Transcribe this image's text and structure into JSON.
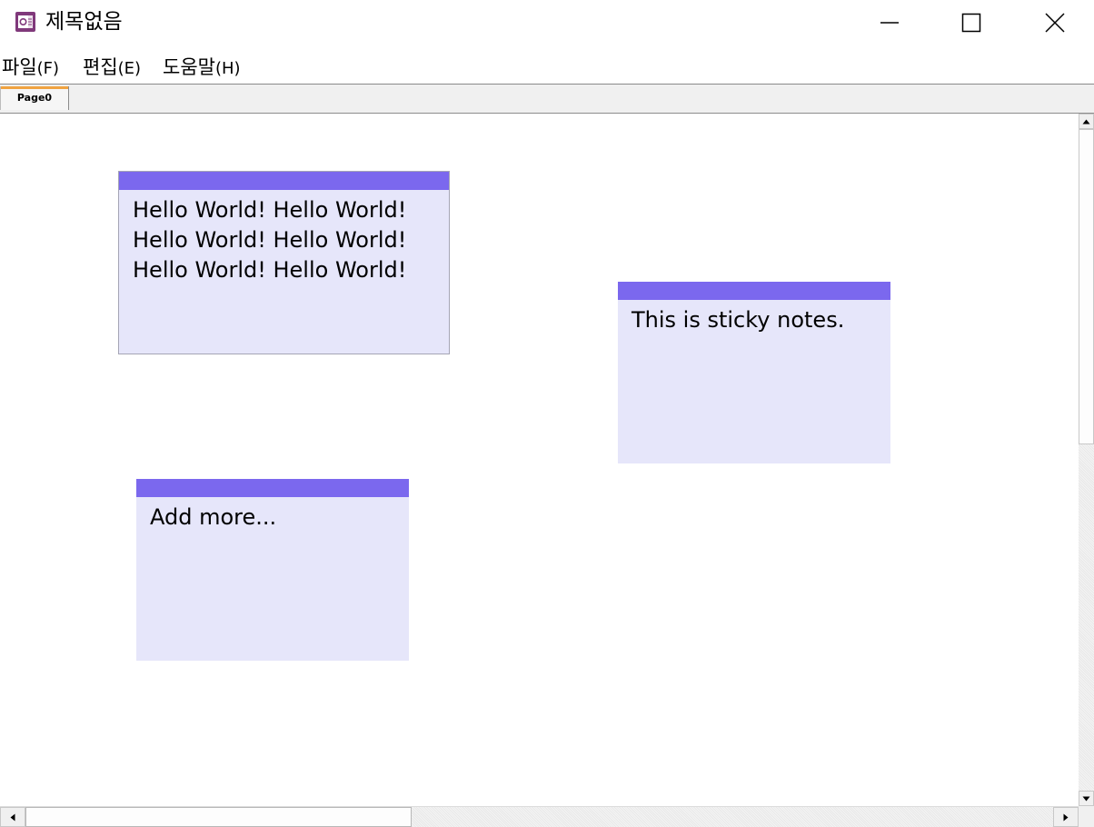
{
  "window": {
    "title": "제목없음",
    "app_icon": "onenote-icon",
    "controls": {
      "minimize_icon": "minimize-icon",
      "maximize_icon": "maximize-icon",
      "close_icon": "close-icon"
    }
  },
  "menubar": {
    "items": [
      {
        "label": "파일",
        "accel": "(F)"
      },
      {
        "label": "편집",
        "accel": "(E)"
      },
      {
        "label": "도움말",
        "accel": "(H)"
      }
    ]
  },
  "tabs": [
    {
      "label": "Page0",
      "active": true
    }
  ],
  "notes": [
    {
      "text": "Hello World! Hello World!\nHello World! Hello World!\nHello World! Hello World!"
    },
    {
      "text": "This is sticky notes."
    },
    {
      "text": "Add more..."
    }
  ],
  "colors": {
    "note_header": "#7b68ee",
    "note_body": "#e6e6fa",
    "tab_accent": "#f0a341"
  }
}
